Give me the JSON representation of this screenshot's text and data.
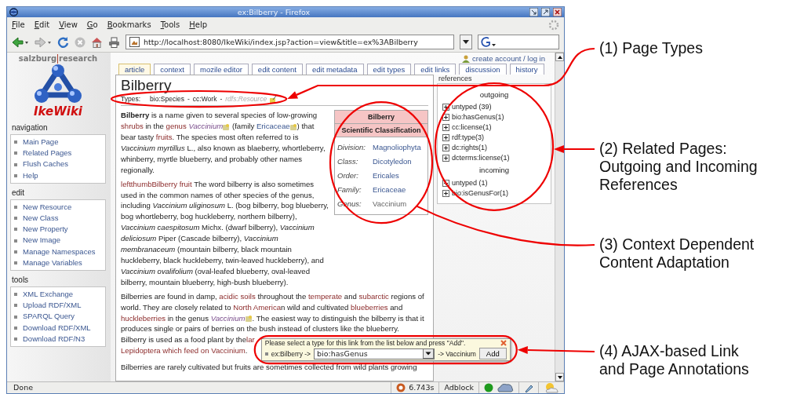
{
  "window": {
    "title": "ex:Bilberry - Firefox"
  },
  "menu": [
    "File",
    "Edit",
    "View",
    "Go",
    "Bookmarks",
    "Tools",
    "Help"
  ],
  "address_bar": {
    "value": "http://localhost:8080/IkeWiki/index.jsp?action=view&title=ex%3ABilberry"
  },
  "logo": {
    "org_left": "salzburg",
    "org_right": "research",
    "name": "IkeWiki"
  },
  "account_link": "create account / log in",
  "tabs": [
    {
      "label": "article",
      "selected": true
    },
    {
      "label": "context",
      "selected": false
    },
    {
      "label": "mozile editor",
      "selected": false
    },
    {
      "label": "edit content",
      "selected": false
    },
    {
      "label": "edit metadata",
      "selected": false
    },
    {
      "label": "edit types",
      "selected": false
    },
    {
      "label": "edit links",
      "selected": false
    },
    {
      "label": "discussion",
      "selected": false
    },
    {
      "label": "history",
      "selected": false
    }
  ],
  "sidebar": [
    {
      "title": "navigation",
      "items": [
        "Main Page",
        "Related Pages",
        "Flush Caches",
        "Help"
      ]
    },
    {
      "title": "edit",
      "items": [
        "New Resource",
        "New Class",
        "New Property",
        "New Image",
        "Manage Namespaces",
        "Manage Variables"
      ]
    },
    {
      "title": "tools",
      "items": [
        "XML Exchange",
        "Upload RDF/XML",
        "SPARQL Query",
        "Download RDF/XML",
        "Download RDF/N3"
      ]
    }
  ],
  "article": {
    "title": "Bilberry",
    "types_label": "Types:",
    "type_separator": "-",
    "types": [
      {
        "text": "bio:Species",
        "inferred": false
      },
      {
        "text": "cc:Work",
        "inferred": false
      },
      {
        "text": "rdfs:Resource",
        "inferred": true
      }
    ],
    "infobox": {
      "title": "Bilberry",
      "subtitle": "Scientific Classification",
      "rows": [
        {
          "label": "Division:",
          "value": "Magnoliophyta",
          "link": true
        },
        {
          "label": "Class:",
          "value": "Dicotyledon",
          "link": true
        },
        {
          "label": "Order:",
          "value": "Ericales",
          "link": true
        },
        {
          "label": "Family:",
          "value": "Ericaceae",
          "link": true
        },
        {
          "label": "Genus:",
          "value": "Vaccinium",
          "link": false
        }
      ]
    },
    "paragraphs": [
      {
        "continues": false,
        "segments": [
          {
            "kind": "text",
            "text": "**Bilberry** is a name given to several species of low-growing "
          },
          {
            "kind": "link",
            "text": "shrubs"
          },
          {
            "kind": "text",
            "text": " in the "
          },
          {
            "kind": "link",
            "text": "genus "
          },
          {
            "kind": "typelink",
            "text": "Vaccinium",
            "annotated": true
          },
          {
            "kind": "text",
            "text": " (family "
          },
          {
            "kind": "bluelink",
            "text": "Ericaceae",
            "annotated": true
          },
          {
            "kind": "text",
            "text": ") that bear tasty "
          },
          {
            "kind": "link",
            "text": "fruits"
          },
          {
            "kind": "text",
            "text": ". The species most often referred to is *Vaccinium myrtillus* L., also known as blaeberry, whortleberry, whinberry, myrtle blueberry, and probably other names regionally."
          }
        ]
      },
      {
        "continues": false,
        "segments": [
          {
            "kind": "link",
            "text": "leftthumbBilberry fruit"
          },
          {
            "kind": "text",
            "text": " The word bilberry is also sometimes used in the common names of other species of the genus, including *Vaccinium uliginosum* L. (bog bilberry, bog blueberry, bog whortleberry, bog huckleberry, northern bilberry), *Vaccinium caespitosum* Michx. (dwarf bilberry), *Vaccinium deliciosum* Piper (Cascade bilberry), *Vaccinium membranaceum* (mountain bilberry, black mountain huckleberry, black huckleberry, twin-leaved huckleberry), and *Vaccinium ovalifolium* (oval-leafed blueberry, oval-leaved bilberry, mountain blueberry, high-bush blueberry)."
          }
        ]
      },
      {
        "continues": false,
        "segments": [
          {
            "kind": "text",
            "text": "Bilberries are found in damp, "
          },
          {
            "kind": "link",
            "text": "acidic "
          },
          {
            "kind": "link",
            "text": "soils"
          },
          {
            "kind": "text",
            "text": " throughout the "
          },
          {
            "kind": "link",
            "text": "temperate"
          },
          {
            "kind": "text",
            "text": " and "
          },
          {
            "kind": "link",
            "text": "subarctic"
          },
          {
            "kind": "text",
            "text": " regions of world. They are closely related to "
          },
          {
            "kind": "link",
            "text": "North America"
          },
          {
            "kind": "text",
            "text": "n wild and cultivated "
          },
          {
            "kind": "link",
            "text": "blueberries"
          },
          {
            "kind": "text",
            "text": " and "
          },
          {
            "kind": "link",
            "text": "huckleberries"
          },
          {
            "kind": "text",
            "text": " in the genus "
          },
          {
            "kind": "typelink",
            "text": "Vaccinium",
            "annotated": true
          },
          {
            "kind": "text",
            "text": ". The easiest way to distinguish the bilberry is that it produces single or pairs of berries on the bush instead of clusters like the blueberry."
          }
        ]
      },
      {
        "continues": true,
        "segments": [
          {
            "kind": "text",
            "text": "Bilberry is used as a food plant by the "
          },
          {
            "kind": "link",
            "text": "lar"
          }
        ]
      },
      {
        "continues": true,
        "segments": [
          {
            "kind": "link",
            "text": "Lepidoptera which feed on Vaccinium"
          },
          {
            "kind": "text",
            "text": "."
          }
        ]
      },
      {
        "continues": false,
        "segments": [
          {
            "kind": "text",
            "text": "Bilberries are rarely cultivated but fruits are sometimes collected from wild plants growing"
          }
        ]
      }
    ]
  },
  "references": {
    "label": "references",
    "groups": [
      {
        "title": "outgoing",
        "items": [
          {
            "label": "untyped (39)",
            "expanded": false
          },
          {
            "label": "bio:hasGenus(1)",
            "expanded": false
          },
          {
            "label": "cc:license(1)",
            "expanded": false
          },
          {
            "label": "rdf:type(3)",
            "expanded": false
          },
          {
            "label": "dc:rights(1)",
            "expanded": false
          },
          {
            "label": "dcterms:license(1)",
            "expanded": false
          }
        ]
      },
      {
        "title": "incoming",
        "items": [
          {
            "label": "untyped (1)",
            "expanded": false
          },
          {
            "label": "bio:isGenusFor(1)",
            "expanded": false
          }
        ]
      }
    ]
  },
  "link_popup": {
    "message": "Please select a type for this link from the list below and press \"Add\".",
    "subject": "ex:Bilberry ->",
    "property": "bio:hasGenus",
    "object": "-> Vaccinium",
    "button": "Add"
  },
  "status_bar": {
    "text": "Done",
    "timer": "6.743s",
    "adblock": "Adblock"
  },
  "annotations": [
    {
      "lines": [
        "(1) Page Types"
      ]
    },
    {
      "lines": [
        "(2) Related Pages:",
        "Outgoing and Incoming",
        "References"
      ]
    },
    {
      "lines": [
        "(3) Context Dependent",
        "Content Adaptation"
      ]
    },
    {
      "lines": [
        "(4) AJAX-based Link",
        "and Page Annotations"
      ]
    }
  ]
}
